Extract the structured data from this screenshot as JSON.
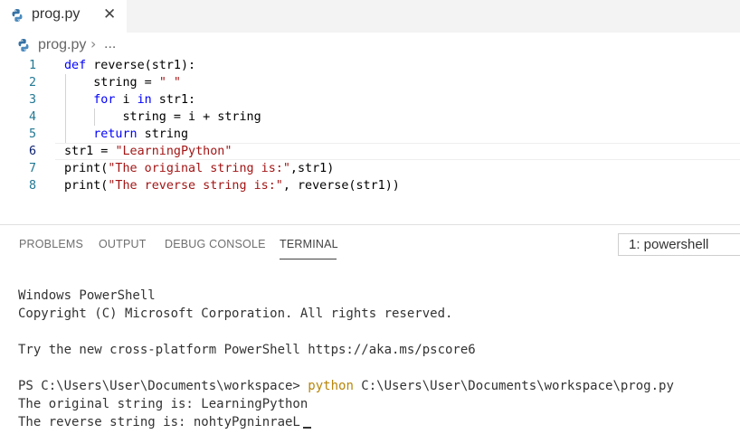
{
  "tab": {
    "filename": "prog.py",
    "close_glyph": "✕",
    "icon": "python-file-icon"
  },
  "breadcrumb": {
    "file": "prog.py",
    "separator": "›",
    "more": "..."
  },
  "editor": {
    "line_numbers": [
      "1",
      "2",
      "3",
      "4",
      "5",
      "6",
      "7",
      "8"
    ],
    "active_line": 6,
    "colors": {
      "keyword": "#0000ff",
      "string": "#a31515",
      "line_number": "#237893"
    },
    "lines": [
      [
        {
          "t": "def",
          "k": "kw"
        },
        {
          "t": " reverse(str1):",
          "k": ""
        }
      ],
      [
        {
          "t": "    string = ",
          "k": ""
        },
        {
          "t": "\" \"",
          "k": "str"
        }
      ],
      [
        {
          "t": "    ",
          "k": ""
        },
        {
          "t": "for",
          "k": "kw"
        },
        {
          "t": " i ",
          "k": ""
        },
        {
          "t": "in",
          "k": "kw"
        },
        {
          "t": " str1:",
          "k": ""
        }
      ],
      [
        {
          "t": "        string = i + string",
          "k": ""
        }
      ],
      [
        {
          "t": "    ",
          "k": ""
        },
        {
          "t": "return",
          "k": "kw"
        },
        {
          "t": " string",
          "k": ""
        }
      ],
      [
        {
          "t": "str1 = ",
          "k": ""
        },
        {
          "t": "\"LearningPython\"",
          "k": "str"
        }
      ],
      [
        {
          "t": "print(",
          "k": ""
        },
        {
          "t": "\"The original string is:\"",
          "k": "str"
        },
        {
          "t": ",str1)",
          "k": ""
        }
      ],
      [
        {
          "t": "print(",
          "k": ""
        },
        {
          "t": "\"The reverse string is:\"",
          "k": "str"
        },
        {
          "t": ", reverse(str1))",
          "k": ""
        }
      ]
    ]
  },
  "panel": {
    "tabs": [
      "PROBLEMS",
      "OUTPUT",
      "DEBUG CONSOLE",
      "TERMINAL"
    ],
    "active_tab": "TERMINAL",
    "terminal_select": "1: powershell"
  },
  "terminal": {
    "line1": "Windows PowerShell",
    "line2": "Copyright (C) Microsoft Corporation. All rights reserved.",
    "line3": "Try the new cross-platform PowerShell https://aka.ms/pscore6",
    "prompt": "PS C:\\Users\\User\\Documents\\workspace> ",
    "command": "python",
    "command_arg": " C:\\Users\\User\\Documents\\workspace\\prog.py",
    "output1": "The original string is: LearningPython",
    "output2": "The reverse string is: nohtyPgninraeL",
    "command_color": "#b8860b"
  }
}
